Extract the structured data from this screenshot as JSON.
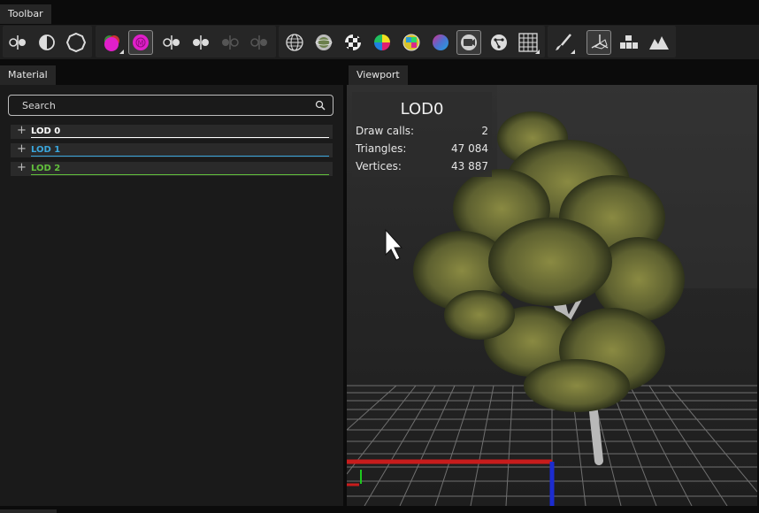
{
  "tabs": {
    "toolbar": "Toolbar",
    "material": "Material",
    "viewport": "Viewport"
  },
  "toolbar": {
    "groups": [
      [
        "half-circle-split-icon",
        "half-moon-icon",
        "circle-outline-icon"
      ],
      [
        "magenta-material-icon",
        "magenta-m-material-icon",
        "half-circle-split-icon",
        "half-circle-split-icon",
        "half-circle-split-faded-icon",
        "half-circle-split-faded-icon"
      ],
      [
        "wireframe-sphere-icon",
        "shaded-sphere-icon",
        "checker-sphere-icon",
        "color-wheel-icon",
        "color-grid-sphere-icon",
        "gradient-sphere-icon",
        "camera-frame-icon",
        "node-graph-icon",
        "grid-icon"
      ],
      [
        "brush-icon",
        "gizmo-axes-icon",
        "blocks-icon",
        "terrain-icon"
      ]
    ],
    "active_buttons": [
      "magenta-m-material-icon",
      "camera-frame-icon",
      "gizmo-axes-icon"
    ]
  },
  "material": {
    "search_placeholder": "Search",
    "lods": [
      {
        "label": "LOD 0",
        "color": "#ffffff"
      },
      {
        "label": "LOD 1",
        "color": "#3aa7dd"
      },
      {
        "label": "LOD 2",
        "color": "#62c13c"
      }
    ]
  },
  "viewport": {
    "stats": {
      "title": "LOD0",
      "rows": [
        {
          "label": "Draw calls:",
          "value": "2"
        },
        {
          "label": "Triangles:",
          "value": "47 084"
        },
        {
          "label": "Vertices:",
          "value": "43 887"
        }
      ]
    }
  }
}
